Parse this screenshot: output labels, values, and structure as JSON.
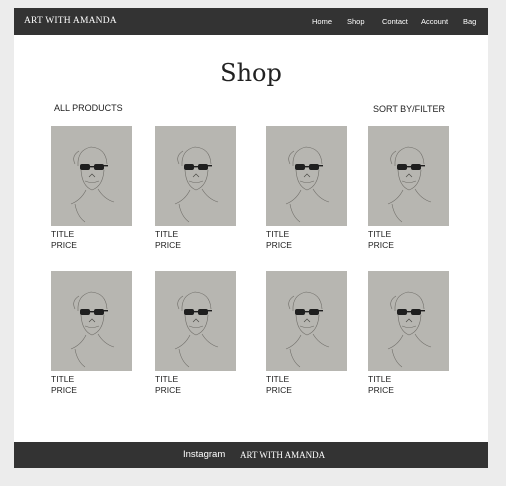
{
  "header": {
    "brand": "ART WITH AMANDA",
    "nav": [
      "Home",
      "Shop",
      "Contact",
      "Account",
      "Bag"
    ]
  },
  "page": {
    "title": "Shop",
    "all_products": "ALL PRODUCTS",
    "sort_filter": "SORT BY/FILTER"
  },
  "products": [
    {
      "title": "TITLE",
      "price": "PRICE"
    },
    {
      "title": "TITLE",
      "price": "PRICE"
    },
    {
      "title": "TITLE",
      "price": "PRICE"
    },
    {
      "title": "TITLE",
      "price": "PRICE"
    },
    {
      "title": "TITLE",
      "price": "PRICE"
    },
    {
      "title": "TITLE",
      "price": "PRICE"
    },
    {
      "title": "TITLE",
      "price": "PRICE"
    },
    {
      "title": "TITLE",
      "price": "PRICE"
    }
  ],
  "footer": {
    "instagram": "Instagram",
    "brand": "ART WITH AMANDA"
  },
  "colors": {
    "bar": "#333333",
    "background": "#ececec",
    "thumbnail": "#b7b6b1"
  }
}
